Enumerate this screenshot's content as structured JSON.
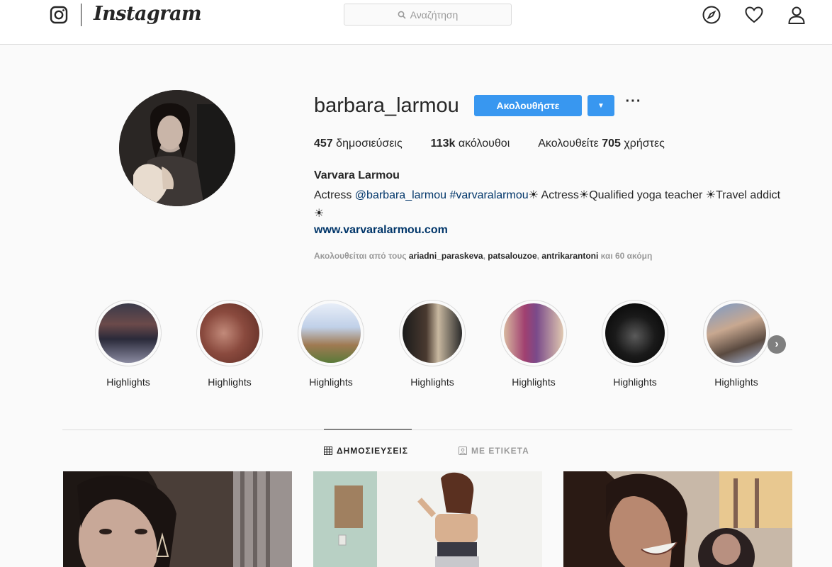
{
  "topnav": {
    "brand": "Instagram",
    "search_placeholder": "Αναζήτηση",
    "icons": [
      "instagram-glyph-icon",
      "compass-icon",
      "heart-icon",
      "user-icon"
    ]
  },
  "profile": {
    "username": "barbara_larmou",
    "follow_label": "Ακολουθήστε",
    "dropdown_label": "▼",
    "more_label": "···",
    "stats": {
      "posts_count": "457",
      "posts_label": "δημοσιεύσεις",
      "followers_count": "113k",
      "followers_label": "ακόλουθοι",
      "following_prefix": "Ακολουθείτε",
      "following_count": "705",
      "following_suffix": "χρήστες"
    },
    "full_name": "Varvara Larmou",
    "bio": {
      "part1": "Actress ",
      "mention": "@barbara_larmou",
      "space1": " ",
      "hashtag": "#varvaralarmou",
      "part2": "☀ Actress☀Qualified yoga teacher ☀Travel addict ☀"
    },
    "website": "www.varvaralarmou.com",
    "followed_by": {
      "prefix": "Ακολουθείται από τους ",
      "name1": "ariadni_paraskeva",
      "sep1": ", ",
      "name2": "patsalouzoe",
      "sep2": ", ",
      "name3": "antrikarantoni",
      "suffix": " και 60 ακόμη"
    }
  },
  "highlights": [
    {
      "label": "Highlights"
    },
    {
      "label": "Highlights"
    },
    {
      "label": "Highlights"
    },
    {
      "label": "Highlights"
    },
    {
      "label": "Highlights"
    },
    {
      "label": "Highlights"
    },
    {
      "label": "Highlights"
    }
  ],
  "highlights_next": "›",
  "tabs": {
    "posts": "ΔΗΜΟΣΙΕΥΣΕΙΣ",
    "tagged": "ΜΕ ΕΤΙΚΕΤΑ"
  },
  "colors": {
    "accent": "#3897f0",
    "link": "#003569",
    "muted": "#999999",
    "border": "#dbdbdb"
  }
}
